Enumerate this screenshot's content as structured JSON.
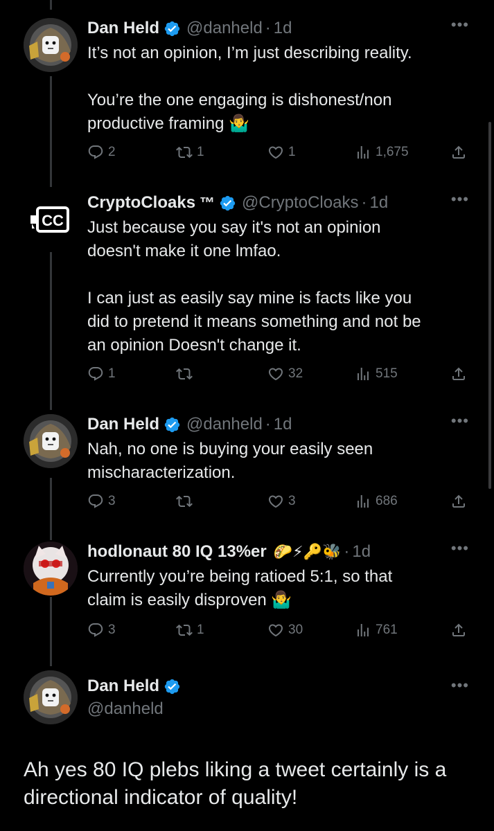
{
  "tweets": [
    {
      "name": "Dan Held",
      "handle": "@danheld",
      "time": "1d",
      "lines": [
        "It’s not an opinion, I’m just describing reality."
      ],
      "lines2": [
        "You’re the one engaging is dishonest/non",
        "productive framing 🤷‍♂️"
      ],
      "stats": {
        "replies": "2",
        "reposts": "1",
        "likes": "1",
        "views": "1,675"
      }
    },
    {
      "name": "CryptoCloaks",
      "tm": "™",
      "handle": "@CryptoCloaks",
      "time": "1d",
      "lines": [
        "Just because you say it's not an opinion",
        "doesn't make it one lmfao."
      ],
      "lines2": [
        "I can just as easily say mine is facts like you",
        "did to pretend it means something and not be",
        "an opinion Doesn't change it."
      ],
      "stats": {
        "replies": "1",
        "reposts": "",
        "likes": "32",
        "views": "515"
      }
    },
    {
      "name": "Dan Held",
      "handle": "@danheld",
      "time": "1d",
      "lines": [
        "Nah, no one is buying your easily seen",
        "mischaracterization."
      ],
      "stats": {
        "replies": "3",
        "reposts": "",
        "likes": "3",
        "views": "686"
      }
    },
    {
      "name": "hodlonaut 80 IQ 13%er",
      "emojis": "🌮⚡🔑🐝",
      "time": "1d",
      "lines": [
        "Currently you’re being ratioed 5:1, so that",
        "claim is easily disproven 🤷‍♂️"
      ],
      "stats": {
        "replies": "3",
        "reposts": "1",
        "likes": "30",
        "views": "761"
      }
    }
  ],
  "main_tweet": {
    "name": "Dan Held",
    "handle": "@danheld",
    "lines": [
      "Ah yes 80 IQ plebs liking a tweet certainly is a",
      "directional indicator of quality!"
    ]
  },
  "colors": {
    "background": "#000000",
    "text": "#e7e9ea",
    "muted": "#71767b",
    "verified": "#1d9bf0"
  },
  "icons": {
    "reply": "reply-icon",
    "repost": "repost-icon",
    "like": "heart-icon",
    "views": "views-icon",
    "share": "share-icon",
    "more": "more-icon",
    "verified": "verified-badge-icon"
  },
  "more_label": "•••"
}
